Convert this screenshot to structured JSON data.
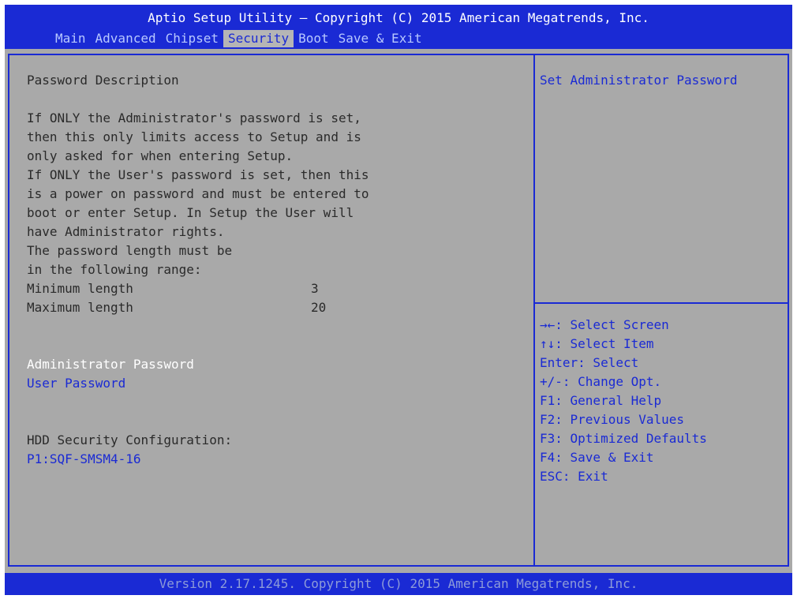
{
  "header": {
    "title": "Aptio Setup Utility – Copyright (C) 2015 American Megatrends, Inc.",
    "tabs": [
      {
        "label": "Main"
      },
      {
        "label": "Advanced"
      },
      {
        "label": "Chipset"
      },
      {
        "label": "Security",
        "active": true
      },
      {
        "label": "Boot"
      },
      {
        "label": "Save & Exit"
      }
    ]
  },
  "main": {
    "section_title": "Password Description",
    "description": [
      "If ONLY the Administrator's password is set,",
      "then this only limits access to Setup and is",
      "only asked for when entering Setup.",
      "If ONLY the User's password is set, then this",
      "is a power on password and must be entered to",
      "boot or enter Setup. In Setup the User will",
      "have Administrator rights.",
      "The password length must be",
      "in the following range:"
    ],
    "min_length": {
      "label": "Minimum length",
      "value": "3"
    },
    "max_length": {
      "label": "Maximum length",
      "value": "20"
    },
    "admin_password": "Administrator Password",
    "user_password": "User Password",
    "hdd_security_label": "HDD Security Configuration:",
    "hdd_device": "P1:SQF-SMSM4-16"
  },
  "help": {
    "text": "Set Administrator Password"
  },
  "keys": [
    "→←: Select Screen",
    "↑↓: Select Item",
    "Enter: Select",
    "+/-: Change Opt.",
    "F1: General Help",
    "F2: Previous Values",
    "F3: Optimized Defaults",
    "F4: Save & Exit",
    "ESC: Exit"
  ],
  "footer": {
    "text": "Version 2.17.1245. Copyright (C) 2015 American Megatrends, Inc."
  },
  "colors": {
    "bios_blue": "#1a2ad4",
    "background_gray": "#a9a9a9",
    "selected_text": "#ffffff"
  }
}
